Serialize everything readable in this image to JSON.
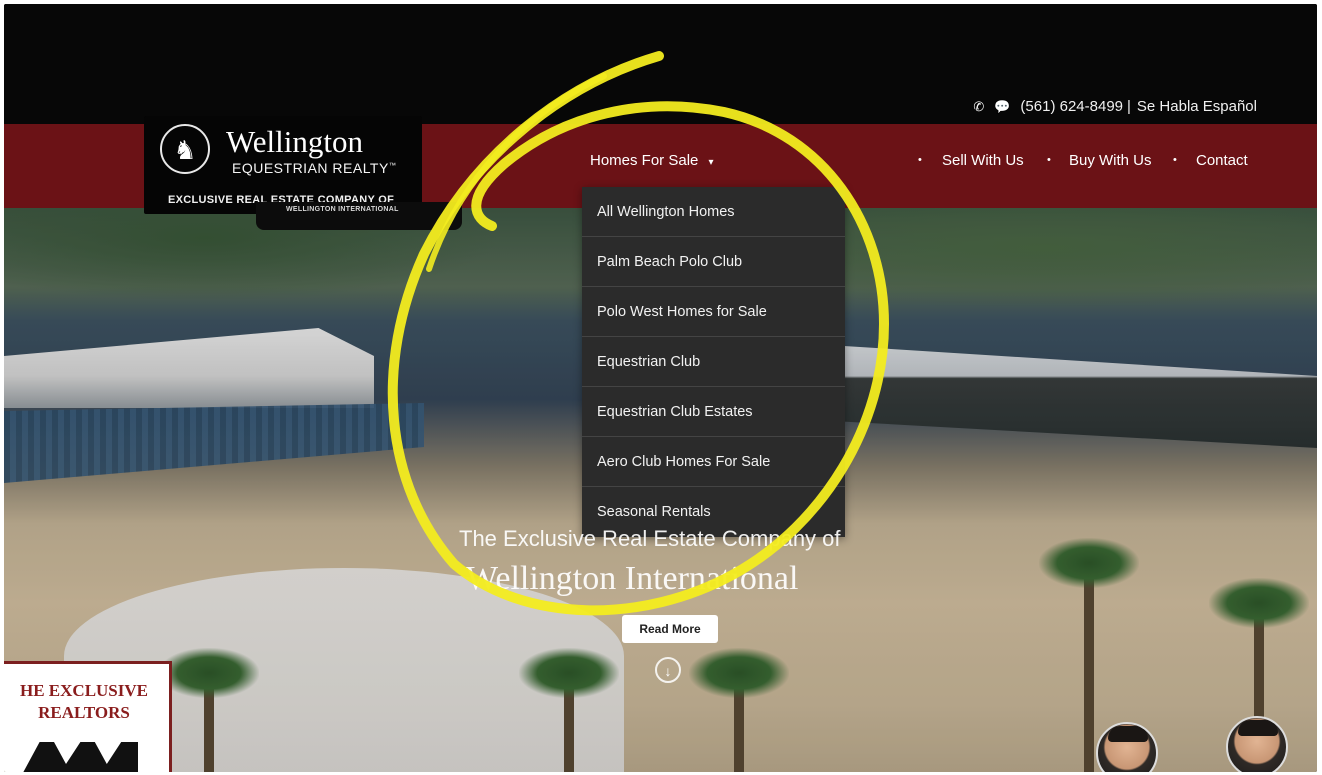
{
  "header": {
    "phone_icon": "phone-ringing-icon",
    "chat_icon": "chat-bubble-icon",
    "phone": "(561) 624-8499",
    "divider": "|",
    "language_note": "Se Habla Español"
  },
  "logo": {
    "name": "Wellington",
    "subtitle": "EQUESTRIAN REALTY",
    "tm": "™",
    "tagline": "EXCLUSIVE REAL ESTATE COMPANY OF",
    "sub_tagline": "WELLINGTON INTERNATIONAL"
  },
  "nav": {
    "items": [
      {
        "label": "Homes For Sale",
        "caret": "▾"
      },
      {
        "label": "Sell With Us"
      },
      {
        "label": "Buy With Us"
      },
      {
        "label": "Contact"
      }
    ],
    "bullet": "•"
  },
  "dropdown": {
    "items": [
      "All Wellington Homes",
      "Palm Beach Polo Club",
      "Polo West Homes for Sale",
      "Equestrian Club",
      "Equestrian Club Estates",
      "Aero Club Homes For Sale",
      "Seasonal Rentals"
    ]
  },
  "hero": {
    "line1": "The Exclusive Real Estate Company of",
    "line2": "Wellington International",
    "cta": "Read More",
    "scroll_icon": "arrow-down-circle-icon"
  },
  "badge": {
    "line1": "HE EXCLUSIVE",
    "line2": "REALTORS"
  },
  "colors": {
    "nav_red": "#6b1216",
    "top_black": "#070707",
    "dropdown_bg": "#2b2b2b",
    "scribble_yellow": "#f3ec1f"
  }
}
